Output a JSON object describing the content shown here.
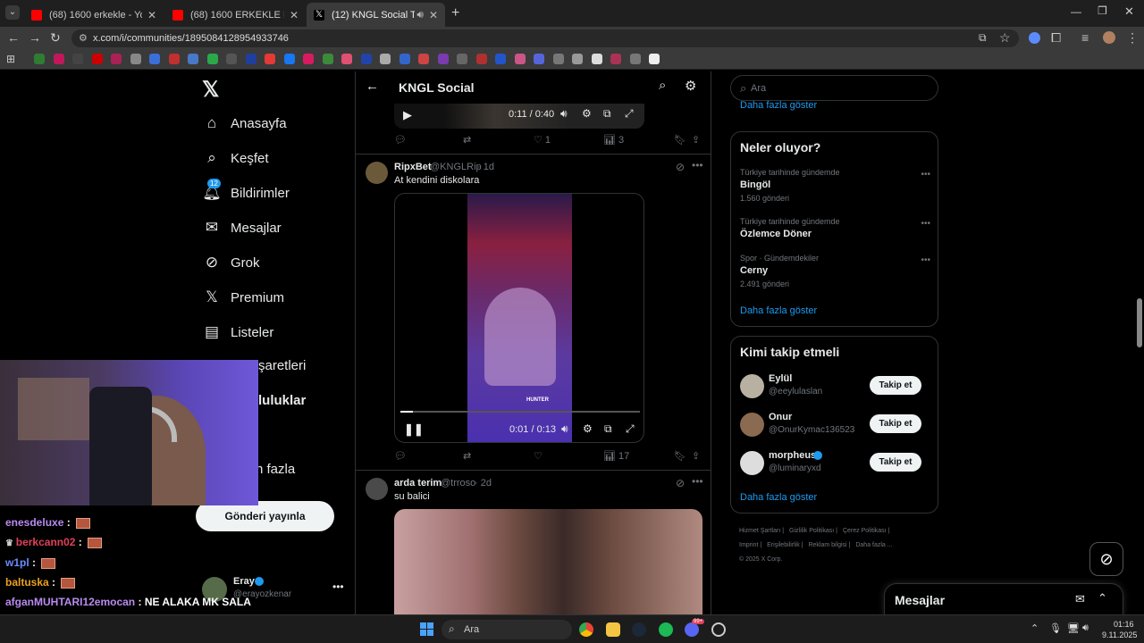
{
  "tabs": [
    {
      "title": "(68) 1600 erkekle - YouTube",
      "color": "#ff0000"
    },
    {
      "title": "(68) 1600 ERKEKLE BİRLİKTE OL",
      "color": "#ff0000"
    },
    {
      "title": "(12) KNGL Social Topluluk / ",
      "color": "#ffffff"
    }
  ],
  "address": {
    "url": "x.com/i/communities/1895084128954933746"
  },
  "left_nav": {
    "items": [
      {
        "label": "Anasayfa",
        "icon": "home-icon"
      },
      {
        "label": "Keşfet",
        "icon": "search-icon"
      },
      {
        "label": "Bildirimler",
        "icon": "bell-icon",
        "badge": "12"
      },
      {
        "label": "Mesajlar",
        "icon": "mail-icon"
      },
      {
        "label": "Grok",
        "icon": "grok-icon"
      },
      {
        "label": "Premium",
        "icon": "x-logo-icon"
      },
      {
        "label": "Listeler",
        "icon": "list-icon"
      },
      {
        "label": "şaretleri",
        "icon": "bookmark-icon"
      },
      {
        "label": "luluklar",
        "icon": "communities-icon"
      },
      {
        "label": "",
        "icon": "profile-icon"
      },
      {
        "label": "n fazla",
        "icon": "more-icon"
      }
    ],
    "post_button": "Gönderi yayınla",
    "account": {
      "name": "Eray",
      "handle": "@erayozkenar"
    }
  },
  "header": {
    "title": "KNGL Social"
  },
  "video1": {
    "time": "0:11 / 0:40",
    "likes": "1",
    "views": "3"
  },
  "post1": {
    "name": "RipxBet",
    "handle": "@KNGLRip",
    "age": "· 1d",
    "text": "At kendini diskolara",
    "time": "0:01 / 0:13",
    "views": "17",
    "watermark": "HUNTER"
  },
  "post2": {
    "name": "arda terim",
    "handle": "@trroso",
    "age": "· 2d",
    "text": "su balici"
  },
  "right": {
    "search_placeholder": "Ara",
    "show_more_top": "Daha fazla göster",
    "trends_title": "Neler oluyor?",
    "trends": [
      {
        "context": "Türkiye tarihinde gündemde",
        "name": "Bingöl",
        "count": "1.560 gönderi"
      },
      {
        "context": "Türkiye tarihinde gündemde",
        "name": "Özlemce Döner",
        "count": ""
      },
      {
        "context": "Spor · Gündemdekiler",
        "name": "Cerny",
        "count": "2.491 gönderi"
      }
    ],
    "trends_more": "Daha fazla göster",
    "follow_title": "Kimi takip etmeli",
    "follow": [
      {
        "name": "Eylül",
        "handle": "@eeylulaslan",
        "button": "Takip et"
      },
      {
        "name": "Onur",
        "handle": "@OnurKymac136523",
        "button": "Takip et"
      },
      {
        "name": "morpheus",
        "handle": "@luminaryxd",
        "button": "Takip et"
      }
    ],
    "follow_more": "Daha fazla göster",
    "footer": [
      "Hizmet Şartları",
      "|",
      "Gizlilik Politikası",
      "|",
      "Çerez Politikası",
      "|",
      "Imprint",
      "|",
      "Erişilebilirlik",
      "|",
      "Reklam bilgisi",
      "|",
      "Daha fazla ...",
      "© 2025 X Corp."
    ],
    "messages": "Mesajlar"
  },
  "chat": [
    {
      "user": "enesdeluxe",
      "color": "#b98af0",
      "msg": ""
    },
    {
      "user": "berkcann02",
      "color": "#e0405a",
      "msg": ""
    },
    {
      "user": "w1pl",
      "color": "#6a8cff",
      "msg": ""
    },
    {
      "user": "baltuska",
      "color": "#e8a020",
      "msg": ""
    },
    {
      "user": "afganMUHTARI12emocan",
      "color": "#b98af0",
      "msg": "NE ALAKA MK SALA"
    }
  ],
  "taskbar": {
    "search": "Ara",
    "time": "01:16",
    "date": "9.11.2025",
    "badge": "99+"
  }
}
